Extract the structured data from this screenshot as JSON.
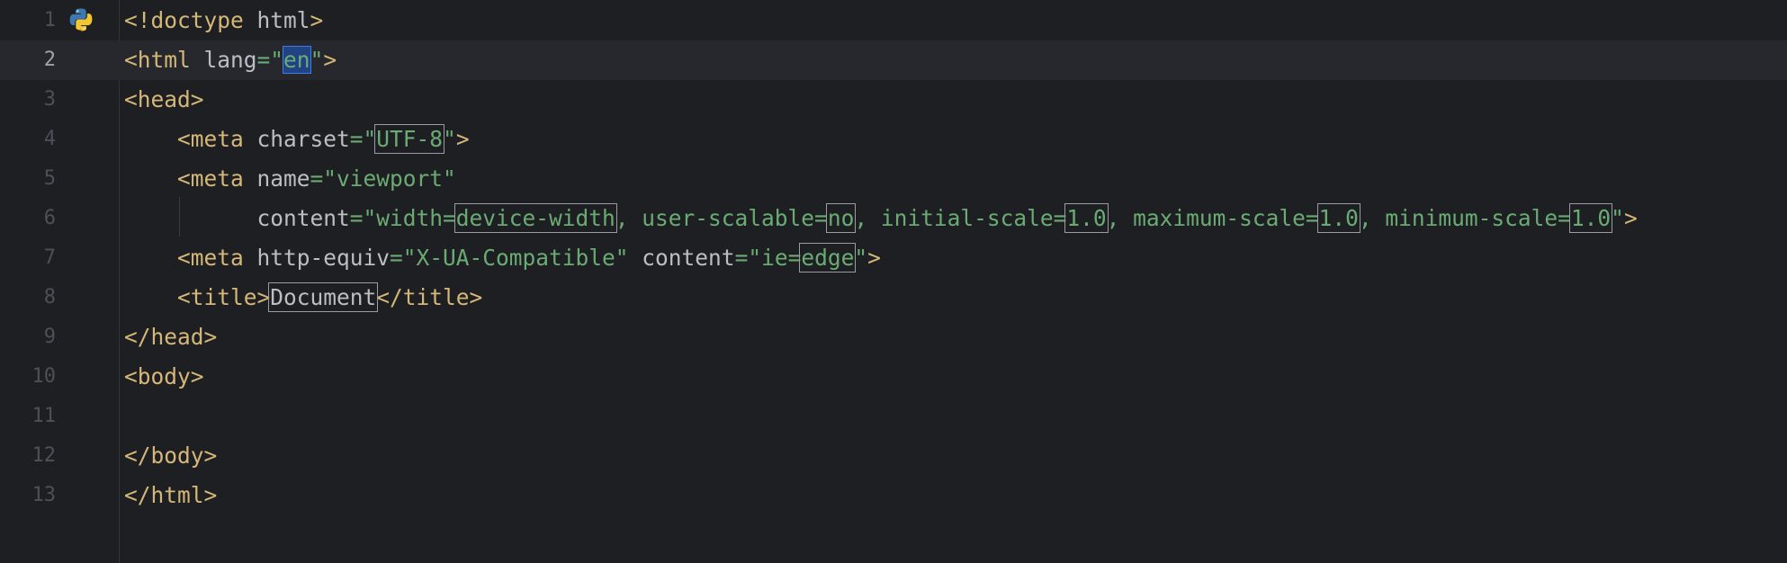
{
  "editor": {
    "lines": [
      {
        "num": "1",
        "tokens": [
          {
            "t": "<!doctype",
            "c": "tag"
          },
          {
            "t": " html",
            "c": "txt"
          },
          {
            "t": ">",
            "c": "tag"
          }
        ]
      },
      {
        "num": "2",
        "tokens": [
          {
            "t": "<html",
            "c": "tag"
          },
          {
            "t": " lang",
            "c": "attr"
          },
          {
            "t": "=\"",
            "c": "str"
          },
          {
            "t": "en",
            "c": "str sel"
          },
          {
            "t": "\"",
            "c": "str"
          },
          {
            "t": ">",
            "c": "tag"
          }
        ]
      },
      {
        "num": "3",
        "tokens": [
          {
            "t": "<head>",
            "c": "tag"
          }
        ]
      },
      {
        "num": "4",
        "tokens": [
          {
            "t": "    <meta",
            "c": "tag"
          },
          {
            "t": " charset",
            "c": "attr"
          },
          {
            "t": "=\"",
            "c": "str"
          },
          {
            "t": "UTF-8",
            "c": "str box"
          },
          {
            "t": "\"",
            "c": "str"
          },
          {
            "t": ">",
            "c": "tag"
          }
        ]
      },
      {
        "num": "5",
        "tokens": [
          {
            "t": "    <meta",
            "c": "tag"
          },
          {
            "t": " name",
            "c": "attr"
          },
          {
            "t": "=\"viewport\"",
            "c": "str"
          }
        ]
      },
      {
        "num": "6",
        "tokens": [
          {
            "t": "          content",
            "c": "attr"
          },
          {
            "t": "=\"width=",
            "c": "str"
          },
          {
            "t": "device-width",
            "c": "str box"
          },
          {
            "t": ", user-scalable=",
            "c": "str"
          },
          {
            "t": "no",
            "c": "str box"
          },
          {
            "t": ", initial-scale=",
            "c": "str"
          },
          {
            "t": "1.0",
            "c": "str box"
          },
          {
            "t": ", maximum-scale=",
            "c": "str"
          },
          {
            "t": "1.0",
            "c": "str box"
          },
          {
            "t": ", minimum-scale=",
            "c": "str"
          },
          {
            "t": "1.0",
            "c": "str box"
          },
          {
            "t": "\"",
            "c": "str"
          },
          {
            "t": ">",
            "c": "tag"
          }
        ]
      },
      {
        "num": "7",
        "tokens": [
          {
            "t": "    <meta",
            "c": "tag"
          },
          {
            "t": " http-equiv",
            "c": "attr"
          },
          {
            "t": "=\"X-UA-Compatible\"",
            "c": "str"
          },
          {
            "t": " content",
            "c": "attr"
          },
          {
            "t": "=\"ie=",
            "c": "str"
          },
          {
            "t": "edge",
            "c": "str box"
          },
          {
            "t": "\"",
            "c": "str"
          },
          {
            "t": ">",
            "c": "tag"
          }
        ]
      },
      {
        "num": "8",
        "tokens": [
          {
            "t": "    <title>",
            "c": "tag"
          },
          {
            "t": "Document",
            "c": "txt box"
          },
          {
            "t": "</title>",
            "c": "tag"
          }
        ]
      },
      {
        "num": "9",
        "tokens": [
          {
            "t": "</head>",
            "c": "tag"
          }
        ]
      },
      {
        "num": "10",
        "tokens": [
          {
            "t": "<body>",
            "c": "tag"
          }
        ]
      },
      {
        "num": "11",
        "tokens": []
      },
      {
        "num": "12",
        "tokens": [
          {
            "t": "</body>",
            "c": "tag"
          }
        ]
      },
      {
        "num": "13",
        "tokens": [
          {
            "t": "</html>",
            "c": "tag"
          }
        ]
      }
    ],
    "current_line": "2",
    "gutter_icon": "python-icon",
    "colors": {
      "background": "#1e1f22",
      "current_line": "#26282e",
      "tag": "#d5b778",
      "attribute": "#bcbec4",
      "string": "#6aab73",
      "line_number": "#4b5059",
      "selection": "#214283"
    }
  }
}
